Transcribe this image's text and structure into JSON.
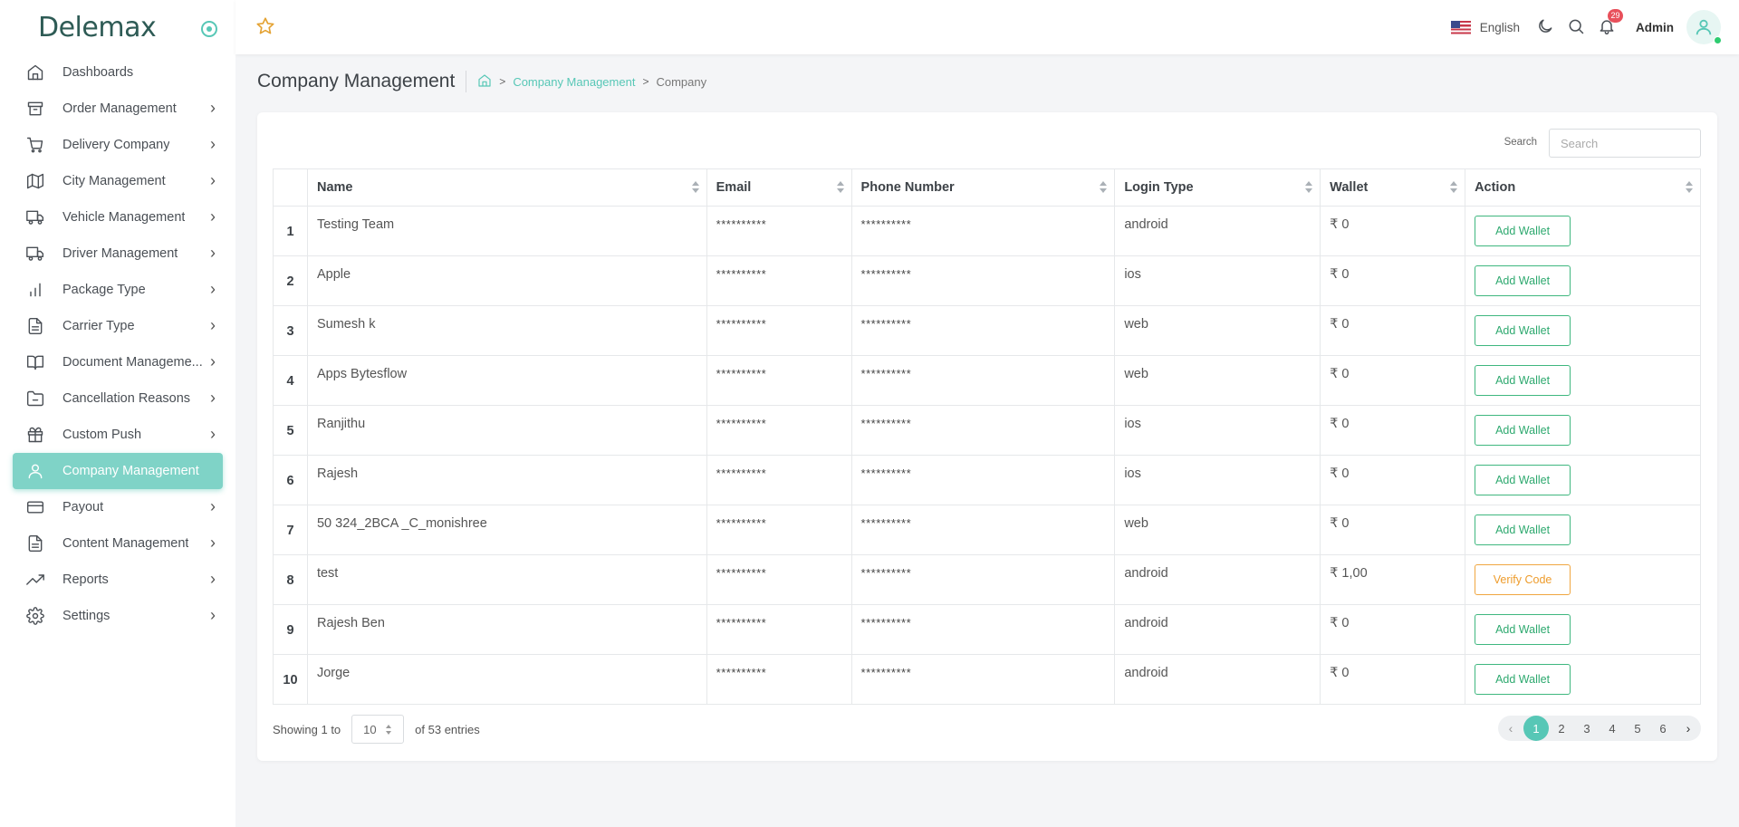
{
  "brand": {
    "name": "Delemax"
  },
  "sidebar": {
    "items": [
      {
        "label": "Dashboards",
        "icon": "home-icon",
        "chevron": false,
        "active": false
      },
      {
        "label": "Order Management",
        "icon": "archive-icon",
        "chevron": true,
        "active": false
      },
      {
        "label": "Delivery Company",
        "icon": "cart-icon",
        "chevron": true,
        "active": false
      },
      {
        "label": "City Management",
        "icon": "map-icon",
        "chevron": true,
        "active": false
      },
      {
        "label": "Vehicle Management",
        "icon": "truck-icon",
        "chevron": true,
        "active": false
      },
      {
        "label": "Driver Management",
        "icon": "truck-icon",
        "chevron": true,
        "active": false
      },
      {
        "label": "Package Type",
        "icon": "bar-chart-icon",
        "chevron": true,
        "active": false
      },
      {
        "label": "Carrier Type",
        "icon": "file-text-icon",
        "chevron": true,
        "active": false
      },
      {
        "label": "Document Manageme...",
        "icon": "book-icon",
        "chevron": true,
        "active": false
      },
      {
        "label": "Cancellation Reasons",
        "icon": "folder-minus-icon",
        "chevron": true,
        "active": false
      },
      {
        "label": "Custom Push",
        "icon": "gift-icon",
        "chevron": true,
        "active": false
      },
      {
        "label": "Company Management",
        "icon": "user-icon",
        "chevron": false,
        "active": true
      },
      {
        "label": "Payout",
        "icon": "credit-card-icon",
        "chevron": true,
        "active": false
      },
      {
        "label": "Content Management",
        "icon": "file-text-icon",
        "chevron": true,
        "active": false
      },
      {
        "label": "Reports",
        "icon": "trending-up-icon",
        "chevron": true,
        "active": false
      },
      {
        "label": "Settings",
        "icon": "settings-icon",
        "chevron": true,
        "active": false
      }
    ]
  },
  "header": {
    "language": "English",
    "notification_count": "29",
    "user_name": "Admin"
  },
  "page": {
    "title": "Company Management",
    "breadcrumb": {
      "link": "Company Management",
      "current": "Company"
    }
  },
  "search": {
    "label": "Search",
    "placeholder": "Search"
  },
  "table": {
    "columns": [
      "",
      "Name",
      "Email",
      "Phone Number",
      "Login Type",
      "Wallet",
      "Action"
    ],
    "rows": [
      {
        "idx": "1",
        "name": "Testing Team",
        "email": "**********",
        "phone": "**********",
        "login": "android",
        "wallet": "₹ 0",
        "action": "Add Wallet",
        "action_type": "add"
      },
      {
        "idx": "2",
        "name": "Apple",
        "email": "**********",
        "phone": "**********",
        "login": "ios",
        "wallet": "₹ 0",
        "action": "Add Wallet",
        "action_type": "add"
      },
      {
        "idx": "3",
        "name": "Sumesh k",
        "email": "**********",
        "phone": "**********",
        "login": "web",
        "wallet": "₹ 0",
        "action": "Add Wallet",
        "action_type": "add"
      },
      {
        "idx": "4",
        "name": "Apps Bytesflow",
        "email": "**********",
        "phone": "**********",
        "login": "web",
        "wallet": "₹ 0",
        "action": "Add Wallet",
        "action_type": "add"
      },
      {
        "idx": "5",
        "name": "Ranjithu",
        "email": "**********",
        "phone": "**********",
        "login": "ios",
        "wallet": "₹ 0",
        "action": "Add Wallet",
        "action_type": "add"
      },
      {
        "idx": "6",
        "name": "Rajesh",
        "email": "**********",
        "phone": "**********",
        "login": "ios",
        "wallet": "₹ 0",
        "action": "Add Wallet",
        "action_type": "add"
      },
      {
        "idx": "7",
        "name": "50 324_2BCA _C_monishree",
        "email": "**********",
        "phone": "**********",
        "login": "web",
        "wallet": "₹ 0",
        "action": "Add Wallet",
        "action_type": "add"
      },
      {
        "idx": "8",
        "name": "test",
        "email": "**********",
        "phone": "**********",
        "login": "android",
        "wallet": "₹ 1,00",
        "action": "Verify Code",
        "action_type": "verify"
      },
      {
        "idx": "9",
        "name": "Rajesh Ben",
        "email": "**********",
        "phone": "**********",
        "login": "android",
        "wallet": "₹ 0",
        "action": "Add Wallet",
        "action_type": "add"
      },
      {
        "idx": "10",
        "name": "Jorge",
        "email": "**********",
        "phone": "**********",
        "login": "android",
        "wallet": "₹ 0",
        "action": "Add Wallet",
        "action_type": "add"
      }
    ]
  },
  "footer": {
    "showing_prefix": "Showing 1 to",
    "page_length": "10",
    "showing_suffix": "of 53 entries",
    "pages": [
      "1",
      "2",
      "3",
      "4",
      "5",
      "6"
    ],
    "current_page": "1",
    "prev": "‹",
    "next": "›"
  },
  "colors": {
    "accent": "#57c7b6",
    "active_nav": "#7fd3c7",
    "add_button": "#3fb77f",
    "verify_button": "#f0a640",
    "badge": "#e8505b"
  }
}
